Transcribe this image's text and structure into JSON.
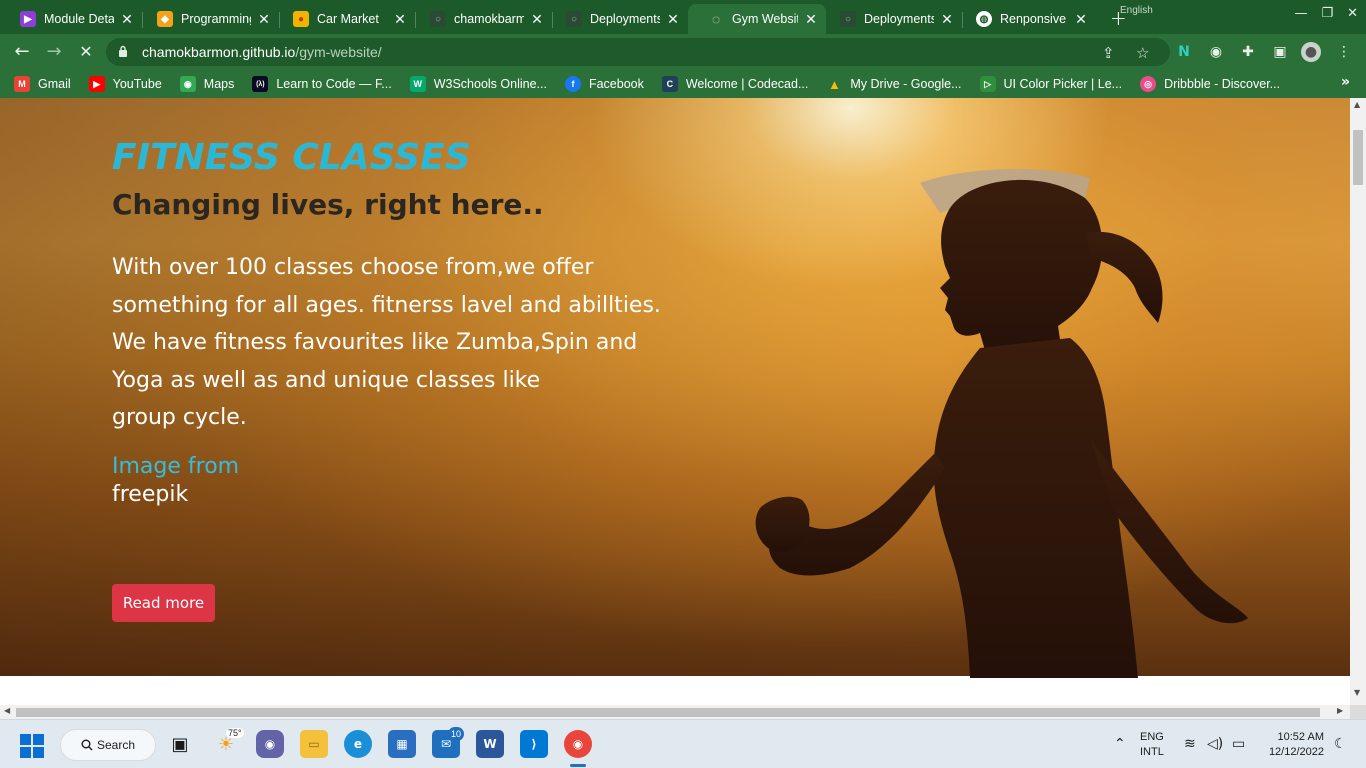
{
  "browser": {
    "tabs": [
      {
        "title": "Module Detai",
        "favicon_color": "#8b3fd6",
        "favicon_glyph": "▶",
        "active": false
      },
      {
        "title": "Programming",
        "favicon_color": "#f4a21a",
        "favicon_glyph": "◆",
        "active": false
      },
      {
        "title": "Car Market",
        "favicon_color": "#f0b400",
        "favicon_glyph": "●",
        "active": false
      },
      {
        "title": "chamokbarm",
        "favicon_color": "#2a4a34",
        "favicon_glyph": "○",
        "active": false
      },
      {
        "title": "Deployments",
        "favicon_color": "#2a4a34",
        "favicon_glyph": "○",
        "active": false
      },
      {
        "title": "Gym Website",
        "favicon_color": "#2a7038",
        "favicon_glyph": "◌",
        "active": true
      },
      {
        "title": "Deployments",
        "favicon_color": "#2a4a34",
        "favicon_glyph": "○",
        "active": false
      },
      {
        "title": "Renponsive W",
        "favicon_color": "#ffffff",
        "favicon_glyph": "◍",
        "active": false
      }
    ],
    "close_glyph": "✕",
    "new_tab_glyph": "+",
    "overlay_lang": "English",
    "url_host": "chamokbarmon.github.io",
    "url_path": "/gym-website/",
    "bookmarks": [
      {
        "label": "Gmail",
        "icon_color": "#ea4335",
        "icon_glyph": "M"
      },
      {
        "label": "YouTube",
        "icon_color": "#ff0000",
        "icon_glyph": "▶"
      },
      {
        "label": "Maps",
        "icon_color": "#34a853",
        "icon_glyph": "◉"
      },
      {
        "label": "Learn to Code — F...",
        "icon_color": "#0a0a23",
        "icon_glyph": "(λ)"
      },
      {
        "label": "W3Schools Online...",
        "icon_color": "#04aa6d",
        "icon_glyph": "W"
      },
      {
        "label": "Facebook",
        "icon_color": "#1877f2",
        "icon_glyph": "f"
      },
      {
        "label": "Welcome | Codecad...",
        "icon_color": "#1f4056",
        "icon_glyph": "C"
      },
      {
        "label": "My Drive - Google...",
        "icon_color": "#fbbc04",
        "icon_glyph": "▲"
      },
      {
        "label": "UI Color Picker | Le...",
        "icon_color": "#2f8f3a",
        "icon_glyph": "▷"
      },
      {
        "label": "Dribbble - Discover...",
        "icon_color": "#ea4c89",
        "icon_glyph": "◎"
      }
    ]
  },
  "hero": {
    "title": "FITNESS CLASSES",
    "subtitle": "Changing lives, right here..",
    "body_lines": [
      "With over 100 classes choose from,we offer",
      "something for all ages. fitnerss lavel and abillties.",
      "We have fitness favourites like Zumba,Spin and",
      "Yoga as well as and unique classes like",
      "group cycle."
    ],
    "image_from_label": "Image from",
    "image_source": "freepik",
    "read_more_label": "Read more",
    "colors": {
      "title": "#2bb8d6",
      "button": "#dc3545",
      "link": "#35bde0"
    }
  },
  "taskbar": {
    "search_label": "Search",
    "weather_temp": "75°",
    "mail_badge": "10",
    "lang_line1": "ENG",
    "lang_line2": "INTL",
    "time": "10:52 AM",
    "date": "12/12/2022"
  }
}
